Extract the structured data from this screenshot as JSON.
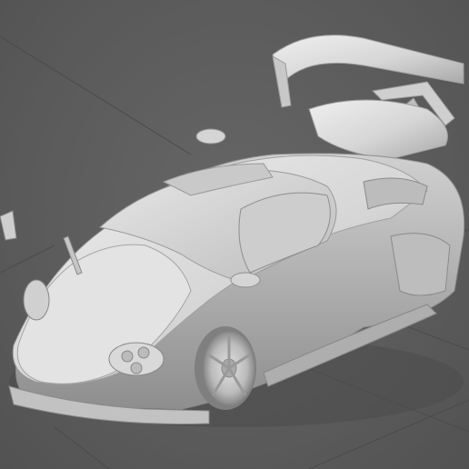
{
  "viewport": {
    "background_color": "#5c5c5c",
    "grid_color": "#4a4a4a",
    "model_color": "#d9d9d9",
    "model_shadow_color": "#9a9a9a",
    "model_highlight_color": "#f2f2f2",
    "view_type": "perspective",
    "shading": "clay",
    "grid": true
  }
}
